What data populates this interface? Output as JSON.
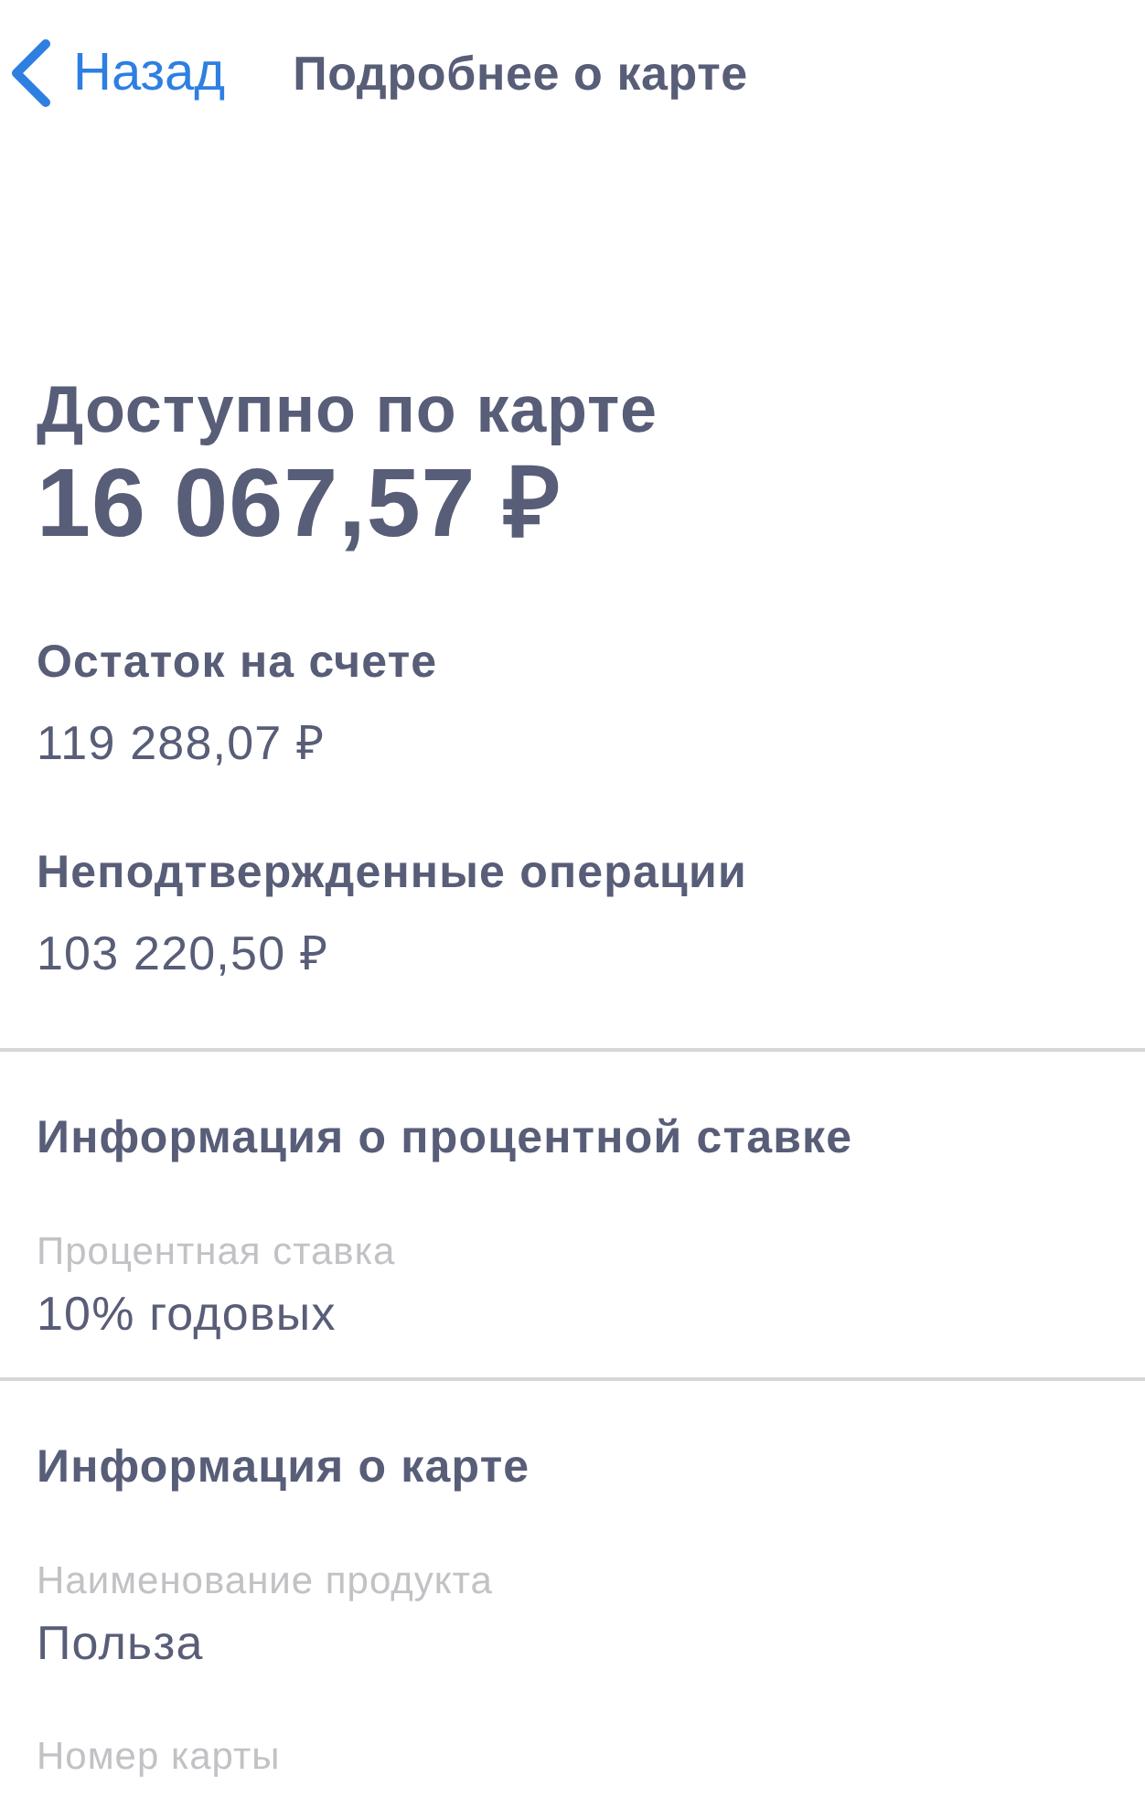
{
  "nav": {
    "back": "Назад",
    "title": "Подробнее о карте"
  },
  "balance": {
    "label": "Доступно по карте",
    "amount": "16 067,57 ₽"
  },
  "details": [
    {
      "label": "Остаток на счете",
      "value": "119 288,07 ₽"
    },
    {
      "label": "Неподтвержденные операции",
      "value": "103 220,50 ₽"
    }
  ],
  "sections": [
    {
      "title": "Информация о процентной ставке",
      "fields": [
        {
          "label": "Процентная ставка",
          "value": "10% годовых"
        }
      ]
    },
    {
      "title": "Информация о карте",
      "fields": [
        {
          "label": "Наименование продукта",
          "value": "Польза"
        },
        {
          "label": "Номер карты"
        }
      ]
    }
  ]
}
